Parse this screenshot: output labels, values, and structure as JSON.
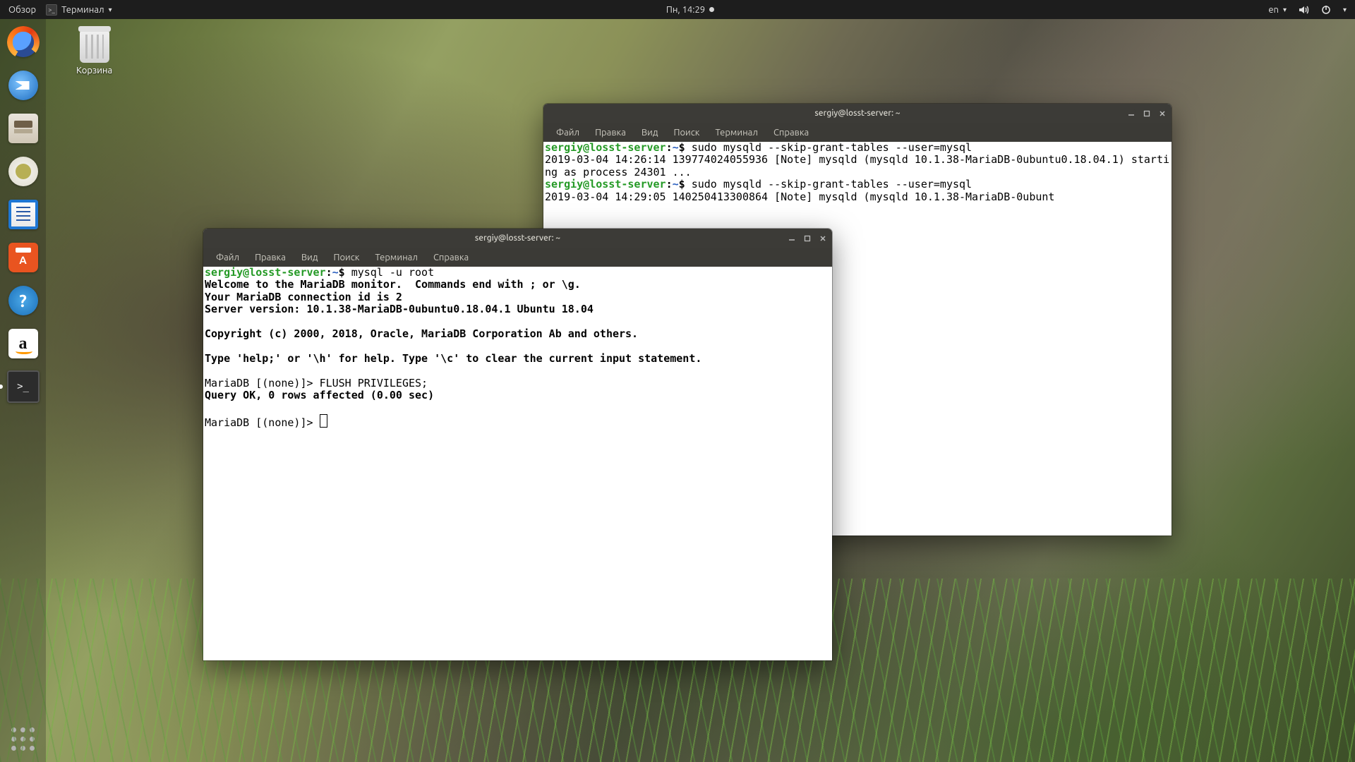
{
  "topbar": {
    "activities": "Обзор",
    "app_label": "Терминал",
    "clock": "Пн, 14:29",
    "input_lang": "en"
  },
  "desktop": {
    "trash_label": "Корзина"
  },
  "launcher": {
    "items": [
      {
        "name": "firefox"
      },
      {
        "name": "thunderbird"
      },
      {
        "name": "files"
      },
      {
        "name": "rhythmbox"
      },
      {
        "name": "libreoffice-writer"
      },
      {
        "name": "ubuntu-software"
      },
      {
        "name": "help"
      },
      {
        "name": "amazon"
      },
      {
        "name": "terminal",
        "active": true
      }
    ]
  },
  "menus": {
    "file": "Файл",
    "edit": "Правка",
    "view": "Вид",
    "search": "Поиск",
    "terminal": "Терминал",
    "help": "Справка"
  },
  "back_window": {
    "title": "sergiy@losst-server: ~",
    "prompt_user": "sergiy@losst-server",
    "prompt_path": "~",
    "cmd1": "sudo mysqld --skip-grant-tables --user=mysql",
    "out1a": "2019-03-04 14:26:14 139774024055936 [Note] mysqld (mysqld 10.1.38-MariaDB-0ubuntu0.18.04.1) starting as process 24301 ...",
    "cmd2": "sudo mysqld --skip-grant-tables --user=mysql",
    "out2a": "2019-03-04 14:29:05 140250413300864 [Note] mysqld (mysqld 10.1.38-MariaDB-0ubunt"
  },
  "front_window": {
    "title": "sergiy@losst-server: ~",
    "prompt_user": "sergiy@losst-server",
    "prompt_path": "~",
    "cmd1": "mysql -u root",
    "welcome1": "Welcome to the MariaDB monitor.  Commands end with ; or \\g.",
    "welcome2": "Your MariaDB connection id is 2",
    "welcome3": "Server version: 10.1.38-MariaDB-0ubuntu0.18.04.1 Ubuntu 18.04",
    "copyright": "Copyright (c) 2000, 2018, Oracle, MariaDB Corporation Ab and others.",
    "helptext": "Type 'help;' or '\\h' for help. Type '\\c' to clear the current input statement.",
    "mariadb_prompt": "MariaDB [(none)]> ",
    "flush_cmd": "FLUSH PRIVILEGES;",
    "flush_result": "Query OK, 0 rows affected (0.00 sec)"
  }
}
